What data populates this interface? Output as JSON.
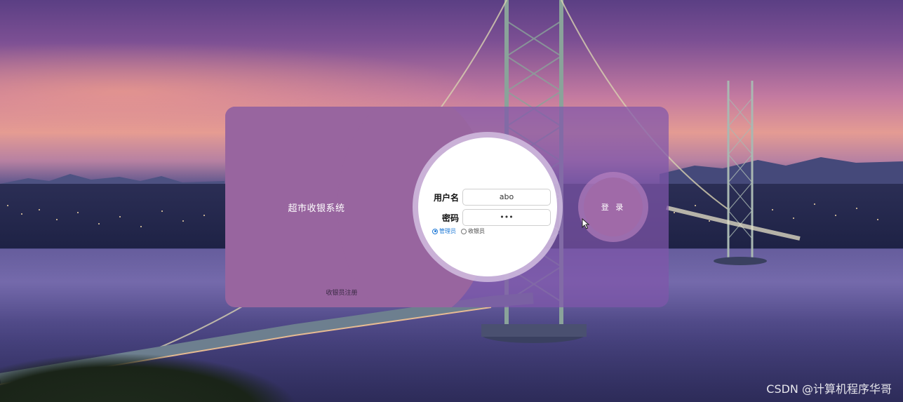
{
  "app": {
    "title": "超市收银系统",
    "register_link": "收银员注册"
  },
  "form": {
    "username_label": "用户名",
    "username_value": "abo",
    "password_label": "密码",
    "password_value": "•••",
    "roles": [
      {
        "label": "管理员",
        "checked": true
      },
      {
        "label": "收银员",
        "checked": false
      }
    ]
  },
  "actions": {
    "login_label": "登 录"
  },
  "watermark": "CSDN @计算机程序华哥",
  "colors": {
    "card_left": "#98659f",
    "login_button": "#a06aa8",
    "radio_accent": "#1e78d6"
  }
}
